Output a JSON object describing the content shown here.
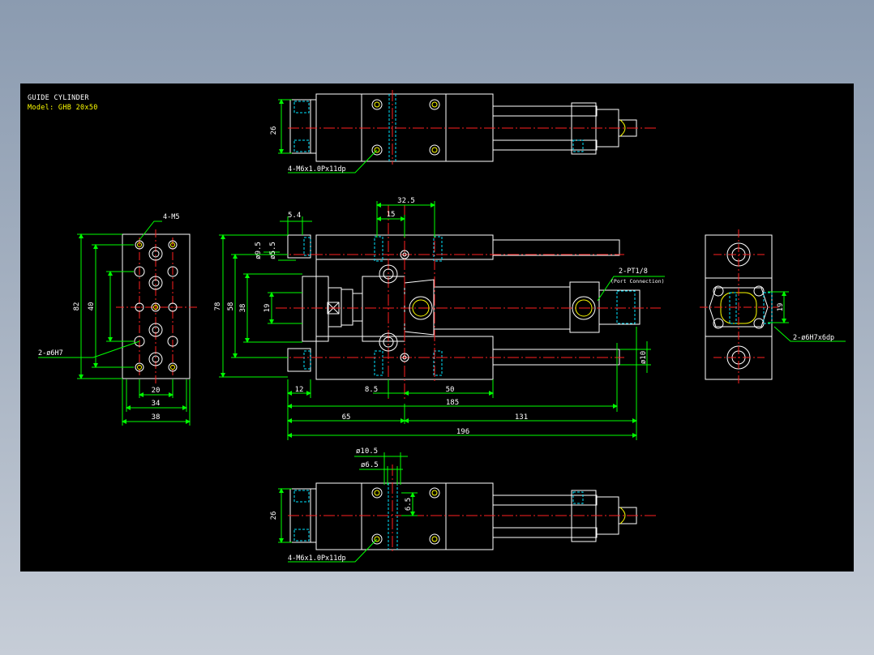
{
  "title_block": {
    "line1": "GUIDE CYLINDER",
    "line2": "Model: GHB 20x50"
  },
  "colors": {
    "background": "#000000",
    "outline": "#ffffff",
    "dimension": "#00ff00",
    "centerline": "#ff2020",
    "hidden": "#00e5ff",
    "hole": "#ffff00",
    "title_line1": "#ffffff",
    "title_line2": "#ffff00"
  },
  "views": {
    "top": {
      "dim_height": "26",
      "thread_note": "4-M6x1.0Px11dp"
    },
    "bottom": {
      "dim_height": "26",
      "dim_bore": "ø10.5",
      "dim_cbore": "ø6.5",
      "dim_depth": "6.5",
      "thread_note": "4-M6x1.0Px11dp"
    },
    "left": {
      "thread_note": "4-M5",
      "pin_note": "2-ø6H7",
      "dim_82": "82",
      "dim_40": "40",
      "dim_20": "20",
      "dim_34": "34",
      "dim_38": "38"
    },
    "front": {
      "dim_5_4": "5.4",
      "dim_32_5": "32.5",
      "dim_15": "15",
      "dim_9_5": "ø9.5",
      "dim_5_5": "ø5.5",
      "dim_78": "78",
      "dim_58": "58",
      "dim_38": "38",
      "dim_19": "19",
      "dim_12": "12",
      "dim_8_5": "8.5",
      "dim_50": "50",
      "dim_185": "185",
      "dim_65": "65",
      "dim_131": "131",
      "dim_196": "196",
      "dim_rod": "ø10",
      "port_note": "2-PT1/8",
      "port_sub": "(Port Connection)"
    },
    "right": {
      "dim_19": "19",
      "pin_note": "2-ø6H7x6dp"
    }
  }
}
